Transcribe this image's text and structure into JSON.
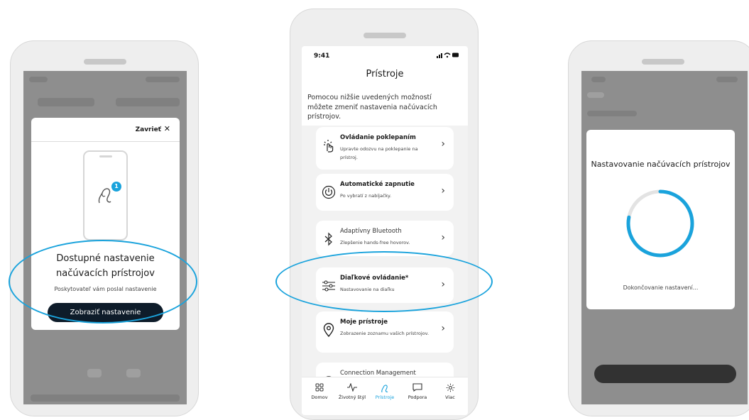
{
  "colors": {
    "accent": "#1aa3dc",
    "dark_button": "#0e1c2a",
    "card_bg": "#ffffff",
    "list_bg": "#f2f2f2"
  },
  "phone1": {
    "modal": {
      "close_label": "Zavrieť",
      "close_icon": "close-icon",
      "badge_count": "1",
      "title": "Dostupné nastavenie načúvacích prístrojov",
      "subtitle": "Poskytovateľ vám poslal nastavenie",
      "button_label": "Zobraziť nastavenie"
    }
  },
  "phone2": {
    "status": {
      "time": "9:41",
      "icons": "signal-wifi-battery"
    },
    "title": "Prístroje",
    "description": "Pomocou nižšie uvedených možností môžete zmeniť nastavenia načúvacích prístrojov.",
    "cards": [
      {
        "icon": "tap-icon",
        "title": "Ovládanie poklepaním",
        "desc": "Upravte odozvu na poklepanie na prístroj."
      },
      {
        "icon": "power-icon",
        "title": "Automatické zapnutie",
        "desc": "Po vybratí z nabíjačky."
      },
      {
        "icon": "bluetooth-icon",
        "title": "Adaptívny Bluetooth",
        "desc": "Zlepšenie hands-free hovorov."
      },
      {
        "icon": "sliders-icon",
        "title": "Diaľkové ovládanie*",
        "desc": "Nastavovanie na diaľku"
      },
      {
        "icon": "location-pin-icon",
        "title": "Moje prístroje",
        "desc": "Zobrazenie zoznamu vašich prístrojov."
      },
      {
        "icon": "connection-icon",
        "title": "Connection Management",
        "desc": ""
      }
    ],
    "tabs": [
      {
        "icon": "grid-icon",
        "label": "Domov"
      },
      {
        "icon": "activity-icon",
        "label": "Životný štýl"
      },
      {
        "icon": "hearing-aid-icon",
        "label": "Prístroje",
        "active": true
      },
      {
        "icon": "chat-icon",
        "label": "Podpora"
      },
      {
        "icon": "gear-icon",
        "label": "Viac"
      }
    ]
  },
  "phone3": {
    "modal": {
      "title": "Nastavovanie načúvacích prístrojov",
      "status": "Dokončovanie nastavení...",
      "progress": 0.78
    }
  }
}
